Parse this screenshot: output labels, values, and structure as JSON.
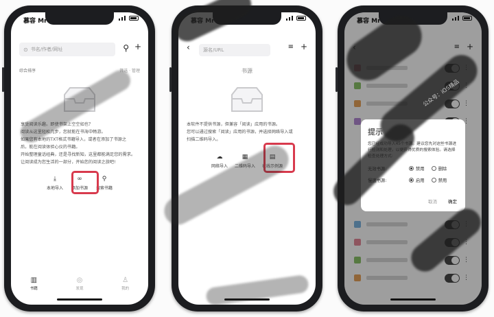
{
  "status_time": "慕容 Mr",
  "screen1": {
    "search_placeholder": "书名/作者/网址",
    "sort_label": "综合排序",
    "sort_right": "筛选 · 管理",
    "empty_lines": [
      "享受阅读乐趣。即使书架上空空如也？",
      "阅读从这里轻松几步，您就能在书海中畅游。",
      "如果您有本地的TXT格式书籍导入，或者在添加了书源之",
      "后，能在阅读体验心仪的书籍。",
      "开始整理童话经典，还是寻找新知，这里都能满足您的需求。",
      "让阅读成为您生活的一部分，开始您的阅读之旅吧!"
    ],
    "actions": [
      "本地导入",
      "添加书源",
      "搜索书籍"
    ],
    "tabs": [
      "书籍",
      "发现",
      "我的"
    ]
  },
  "screen2": {
    "addr_placeholder": "源名/URL",
    "top_title": "书源",
    "empty_lines": [
      "本软件不提供书源，但兼容「阅读」应用的书源。",
      "您可以通过搜索「阅读」应用的书源，并选择网络导入或",
      "扫描二维码导入。"
    ],
    "actions": [
      "网络导入",
      "二维码导入",
      "在线示例源"
    ]
  },
  "screen3": {
    "dialog": {
      "title": "提示",
      "body": "您已经成功导入45个书源。建议您先对这些书源进行检测和处理，以便获得优质的搜索体验。请选择检查处理方式:",
      "rows": [
        {
          "label": "无效书源:",
          "opt1": "禁用",
          "opt2": "删除"
        },
        {
          "label": "慢速书源:",
          "opt1": "启用",
          "opt2": "禁用"
        }
      ],
      "cancel": "取消",
      "ok": "确定"
    }
  },
  "watermark": "公众号：iOS精品"
}
